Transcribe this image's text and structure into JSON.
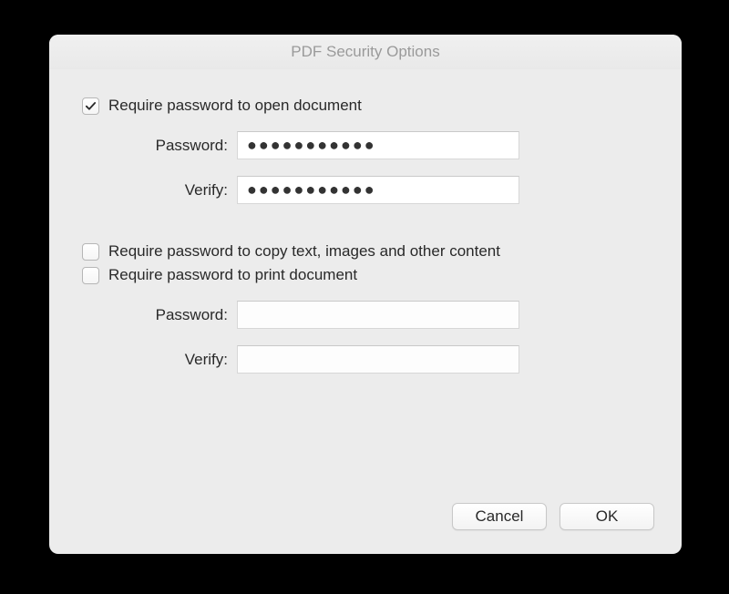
{
  "dialog": {
    "title": "PDF Security Options"
  },
  "open_section": {
    "require_label": "Require password to open document",
    "require_checked": true,
    "password_label": "Password:",
    "password_value": "●●●●●●●●●●●",
    "verify_label": "Verify:",
    "verify_value": "●●●●●●●●●●●"
  },
  "perm_section": {
    "copy_label": "Require password to copy text, images and other content",
    "copy_checked": false,
    "print_label": "Require password to print document",
    "print_checked": false,
    "password_label": "Password:",
    "password_value": "",
    "verify_label": "Verify:",
    "verify_value": ""
  },
  "buttons": {
    "cancel": "Cancel",
    "ok": "OK"
  }
}
